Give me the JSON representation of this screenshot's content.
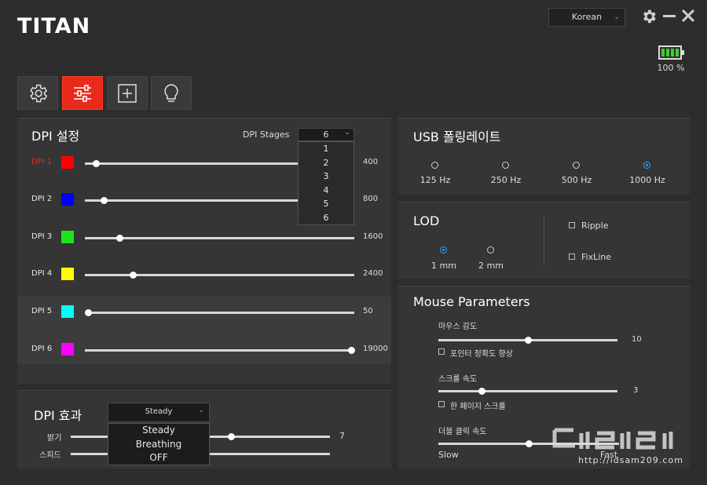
{
  "app": {
    "logo": "TITAN"
  },
  "header": {
    "language": "Korean",
    "battery_percent_text": "100 %",
    "battery_level": 1.0
  },
  "tabs": [
    {
      "icon": "gear-icon"
    },
    {
      "icon": "sliders-icon",
      "active": true
    },
    {
      "icon": "plus-box-icon"
    },
    {
      "icon": "bulb-icon"
    }
  ],
  "dpi_settings": {
    "title": "DPI 설정",
    "stages_label": "DPI Stages",
    "stages_value": "6",
    "stage_options": [
      "1",
      "2",
      "3",
      "4",
      "5",
      "6"
    ],
    "rows": [
      {
        "label": "DPI 1",
        "color": "#ff0000",
        "value": "400",
        "level": 0.03,
        "selected": true
      },
      {
        "label": "DPI 2",
        "color": "#0000ff",
        "value": "800",
        "level": 0.06
      },
      {
        "label": "DPI 3",
        "color": "#19e619",
        "value": "1600",
        "level": 0.12
      },
      {
        "label": "DPI 4",
        "color": "#ffff00",
        "value": "2400",
        "level": 0.17
      },
      {
        "label": "DPI 5",
        "color": "#00ffff",
        "value": "50",
        "level": 0.0
      },
      {
        "label": "DPI 6",
        "color": "#ff00ff",
        "value": "19000",
        "level": 1.0
      }
    ]
  },
  "dpi_effect": {
    "title": "DPI 효과",
    "mode": "Steady",
    "options": [
      "Steady",
      "Breathing",
      "OFF"
    ],
    "brightness_label": "밝기",
    "brightness_value": "7",
    "brightness_level": 0.62,
    "speed_label": "스피드"
  },
  "usb_polling": {
    "title": "USB 폴링레이트",
    "options": [
      "125 Hz",
      "250 Hz",
      "500 Hz",
      "1000 Hz"
    ],
    "selected": "1000 Hz"
  },
  "lod": {
    "title": "LOD",
    "options": [
      "1 mm",
      "2 mm"
    ],
    "selected": "1 mm",
    "ripple_label": "Ripple",
    "fixline_label": "FixLine"
  },
  "mouse_params": {
    "title": "Mouse Parameters",
    "sensitivity_label": "마우스 감도",
    "sensitivity_value": "10",
    "sensitivity_level": 0.5,
    "pointer_precision_label": "포인터 정확도 향상",
    "scroll_label": "스크롤 속도",
    "scroll_value": "3",
    "scroll_level": 0.23,
    "page_scroll_label": "한 페이지 스크롤",
    "double_click_label": "더블 클릭 속도",
    "slow_label": "Slow",
    "fast_label": "Fast",
    "double_click_level": 0.5
  },
  "watermark": {
    "text": "http://idsam209.com"
  }
}
